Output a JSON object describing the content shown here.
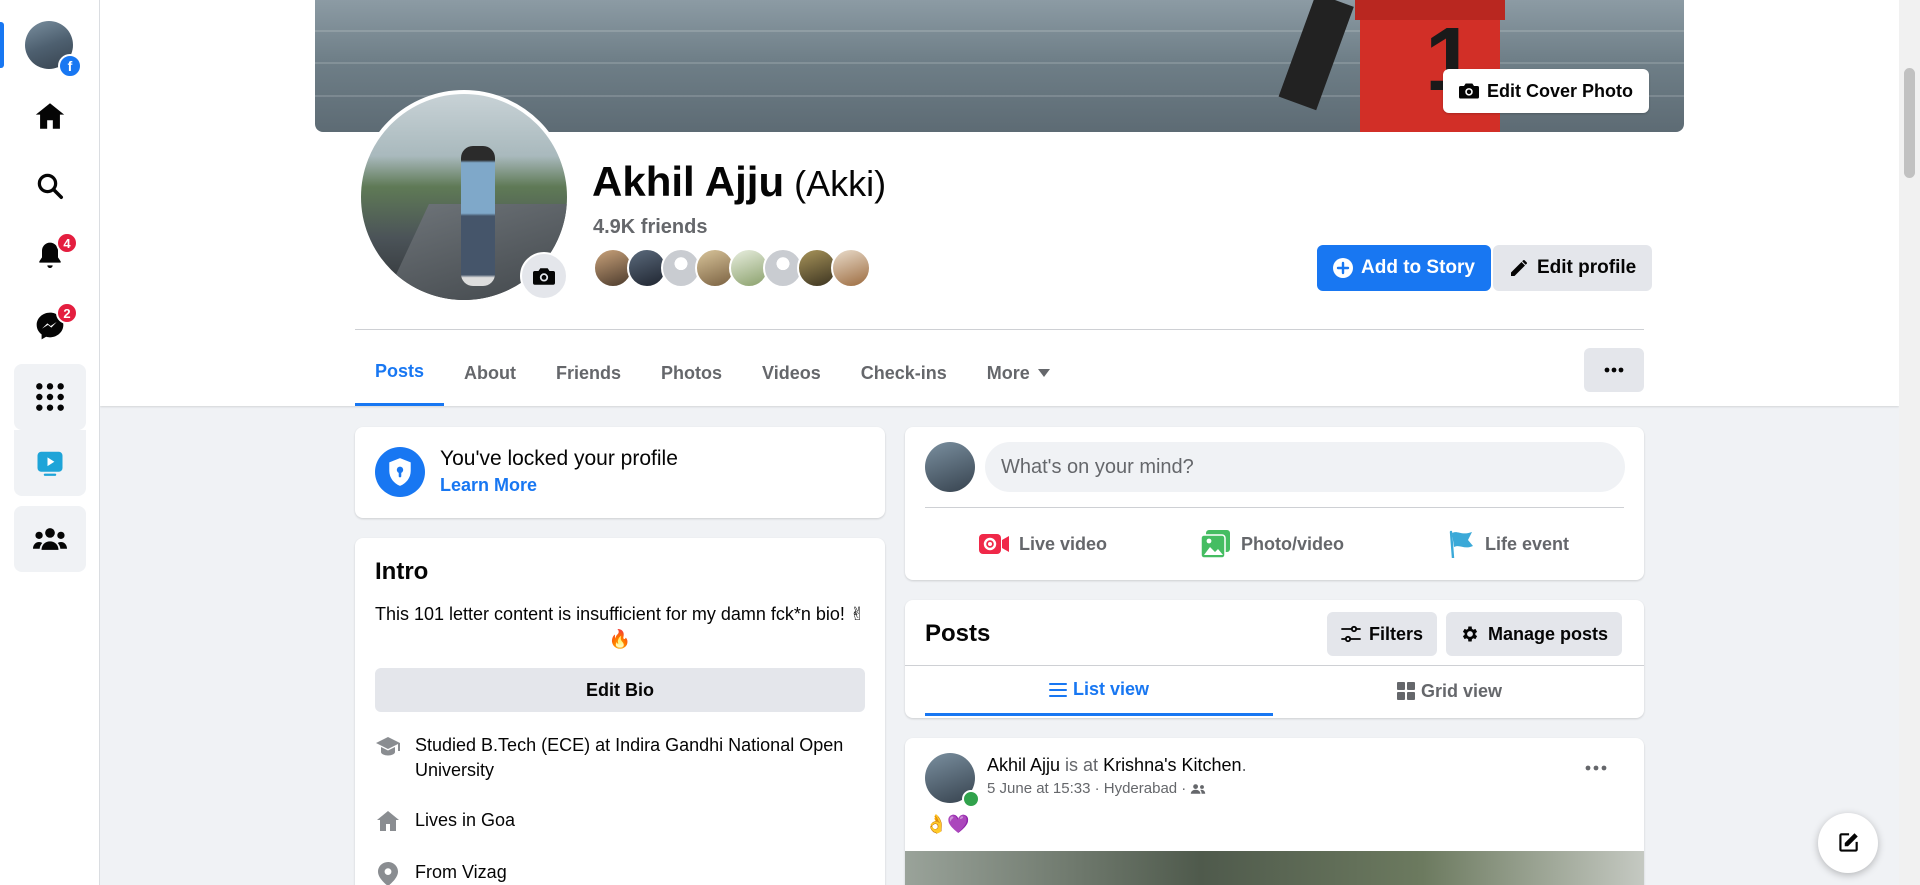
{
  "rail": {
    "notifications_count": "4",
    "messenger_count": "2",
    "icons": [
      "home-icon",
      "search-icon",
      "bell-icon",
      "messenger-icon",
      "menu-grid-icon",
      "watch-icon",
      "groups-icon"
    ]
  },
  "cover": {
    "edit_cover_label": "Edit Cover Photo"
  },
  "profile": {
    "name": "Akhil Ajju",
    "nickname": "(Akki)",
    "friends": "4.9K friends",
    "add_story_label": "Add to Story",
    "edit_profile_label": "Edit profile"
  },
  "tabs": [
    "Posts",
    "About",
    "Friends",
    "Photos",
    "Videos",
    "Check-ins",
    "More"
  ],
  "lock": {
    "title": "You've locked your profile",
    "link": "Learn More"
  },
  "intro": {
    "title": "Intro",
    "bio": "This 101 letter content is insufficient for my damn fck*n bio! ✌ 🔥",
    "edit_bio_label": "Edit Bio",
    "studied_prefix": "Studied B.Tech (ECE) at ",
    "studied_place": "Indira Gandhi National Open University",
    "lives_prefix": "Lives in ",
    "lives_place": "Goa",
    "from_prefix": "From ",
    "from_place": "Vizag"
  },
  "composer": {
    "placeholder": "What's on your mind?",
    "live_label": "Live video",
    "photo_label": "Photo/video",
    "life_label": "Life event"
  },
  "posts": {
    "title": "Posts",
    "filters_label": "Filters",
    "manage_label": "Manage posts",
    "list_view_label": "List view",
    "grid_view_label": "Grid view"
  },
  "post": {
    "author": "Akhil Ajju",
    "is_at": " is at ",
    "place": "Krishna's Kitchen",
    "period": ".",
    "meta": "5 June at 15:33 · Hyderabad ·",
    "emoji": "👌💜"
  },
  "colors": {
    "accent": "#1877f2",
    "badge": "#e41e3f",
    "online": "#31a24c",
    "background": "#f0f2f5"
  }
}
